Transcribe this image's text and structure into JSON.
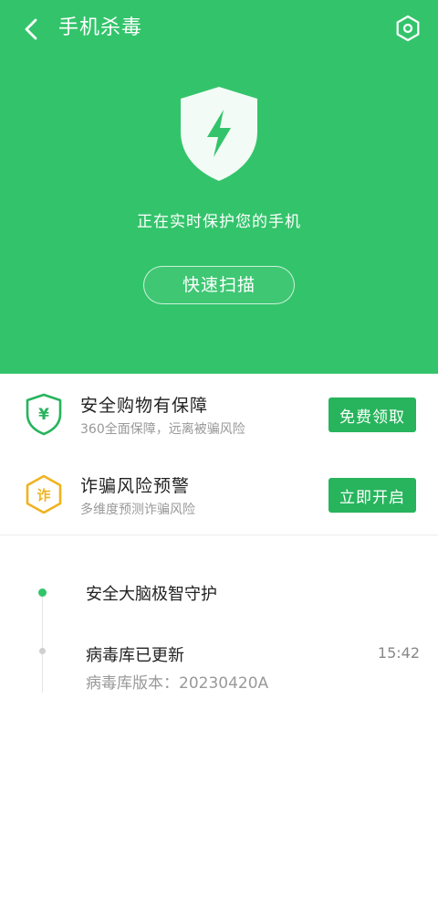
{
  "header": {
    "title": "手机杀毒",
    "back_icon": "chevron-left-icon",
    "settings_icon": "hexagon-settings-icon"
  },
  "hero": {
    "status_text": "正在实时保护您的手机",
    "scan_button_label": "快速扫描",
    "shield_icon": "shield-lightning-icon",
    "background_color": "#33c46b"
  },
  "cards": [
    {
      "title": "安全购物有保障",
      "subtitle": "360全面保障，远离被骗风险",
      "button_label": "免费领取",
      "icon": "shield-yen-icon",
      "icon_color": "#27b45c"
    },
    {
      "title": "诈骗风险预警",
      "subtitle": "多维度预测诈骗风险",
      "button_label": "立即开启",
      "icon": "hexagon-fraud-icon",
      "icon_glyph": "诈",
      "icon_color": "#f0b31f"
    }
  ],
  "timeline": [
    {
      "title": "安全大脑极智守护",
      "status": "active"
    },
    {
      "title": "病毒库已更新",
      "time": "15:42",
      "subtitle": "病毒库版本：20230420A",
      "status": "inactive"
    }
  ],
  "colors": {
    "accent": "#33c46b",
    "button": "#27b45c",
    "warning": "#f0b31f"
  }
}
